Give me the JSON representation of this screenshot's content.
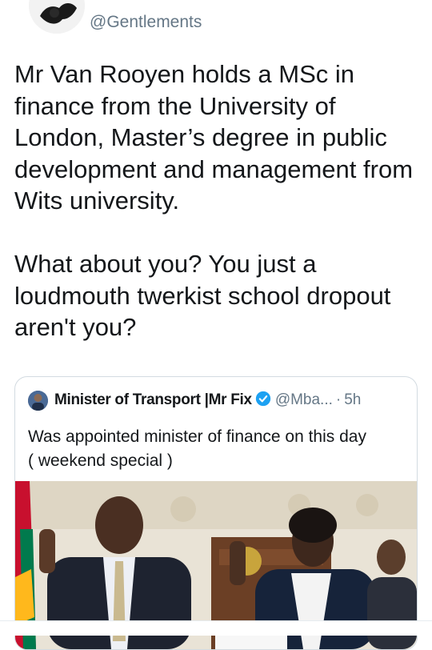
{
  "tweet": {
    "handle": "@Gentlements",
    "text": "Mr Van Rooyen holds a MSc in finance from the University of London, Master’s degree in public development and management from Wits university.\n\nWhat about you? You just a loudmouth twerkist school dropout aren't you?"
  },
  "quoted_tweet": {
    "display_name": "Minister of Transport |Mr Fix",
    "username": "@Mba...",
    "separator": "·",
    "time": "5h",
    "text": "Was appointed minister of finance on this day\n( weekend special )",
    "verified": true
  },
  "icons": {
    "avatar": "avatar-image",
    "quoted_avatar": "avatar-image",
    "verified": "verified-badge-icon",
    "photo": "swearing-in-photo"
  },
  "colors": {
    "text": "#14171a",
    "secondary": "#657786",
    "verified": "#1da1f2",
    "border": "#d3dbe1"
  }
}
